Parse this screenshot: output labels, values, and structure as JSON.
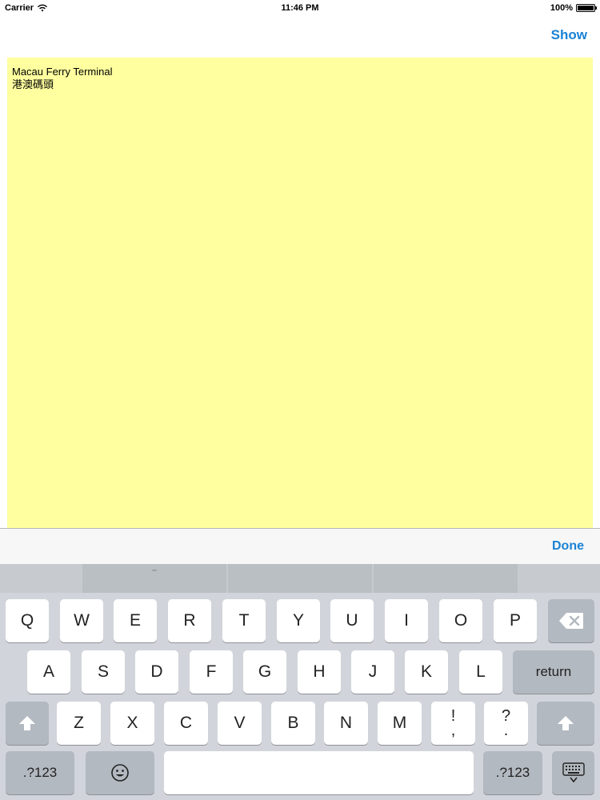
{
  "status_bar": {
    "carrier": "Carrier",
    "time": "11:46 PM",
    "battery": "100%",
    "battery_level": 1.0
  },
  "nav": {
    "show_label": "Show"
  },
  "note": {
    "lines": [
      "Macau Ferry Terminal",
      "港澳碼頭"
    ]
  },
  "accessory": {
    "done_label": "Done"
  },
  "keyboard": {
    "suggestions": [
      "\"\"",
      "",
      ""
    ],
    "row1": [
      "Q",
      "W",
      "E",
      "R",
      "T",
      "Y",
      "U",
      "I",
      "O",
      "P"
    ],
    "row2": [
      "A",
      "S",
      "D",
      "F",
      "G",
      "H",
      "J",
      "K",
      "L"
    ],
    "return_label": "return",
    "row3": [
      "Z",
      "X",
      "C",
      "V",
      "B",
      "N",
      "M"
    ],
    "punct1": {
      "top": "!",
      "bottom": ","
    },
    "punct2": {
      "top": "?",
      "bottom": "."
    },
    "numbers_label": ".?123",
    "icons": {
      "backspace": "backspace-icon",
      "shift": "shift-icon",
      "emoji": "emoji-icon",
      "hide_keyboard": "keyboard-hide-icon"
    }
  },
  "colors": {
    "accent": "#1a82d6",
    "note_background": "#ffff9f",
    "keyboard_background": "#d1d5db"
  }
}
